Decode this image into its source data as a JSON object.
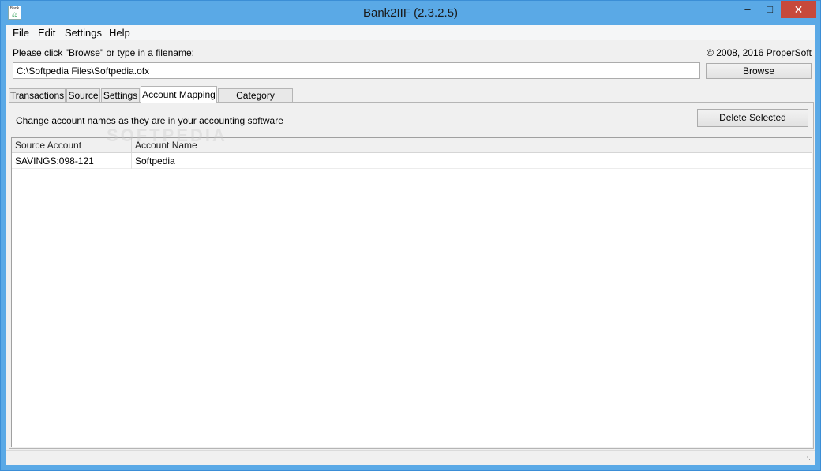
{
  "window": {
    "title": "Bank2IIF (2.3.2.5)",
    "icon_text": "Bank",
    "controls": {
      "minimize": "–",
      "maximize": "□",
      "close": "✕"
    }
  },
  "menu": [
    "File",
    "Edit",
    "Settings",
    "Help"
  ],
  "header": {
    "prompt": "Please click \"Browse\" or type in a filename:",
    "copyright": "© 2008, 2016 ProperSoft"
  },
  "file": {
    "path": "C:\\Softpedia Files\\Softpedia.ofx",
    "browse_label": "Browse"
  },
  "tabs": [
    {
      "label": "Transactions",
      "active": false
    },
    {
      "label": "Source",
      "active": false
    },
    {
      "label": "Settings",
      "active": false
    },
    {
      "label": "Account Mapping",
      "active": true
    },
    {
      "label": "Category Mapping",
      "active": false
    }
  ],
  "panel": {
    "description": "Change account names as they are in your accounting software",
    "delete_label": "Delete Selected"
  },
  "grid": {
    "columns": [
      "Source Account",
      "Account Name"
    ],
    "rows": [
      [
        "SAVINGS:098-121",
        "Softpedia"
      ]
    ]
  },
  "watermark": "SOFTPEDIA",
  "colors": {
    "titlebar": "#5aa9e6",
    "close_button": "#c7493b",
    "client": "#f0f0f0"
  }
}
